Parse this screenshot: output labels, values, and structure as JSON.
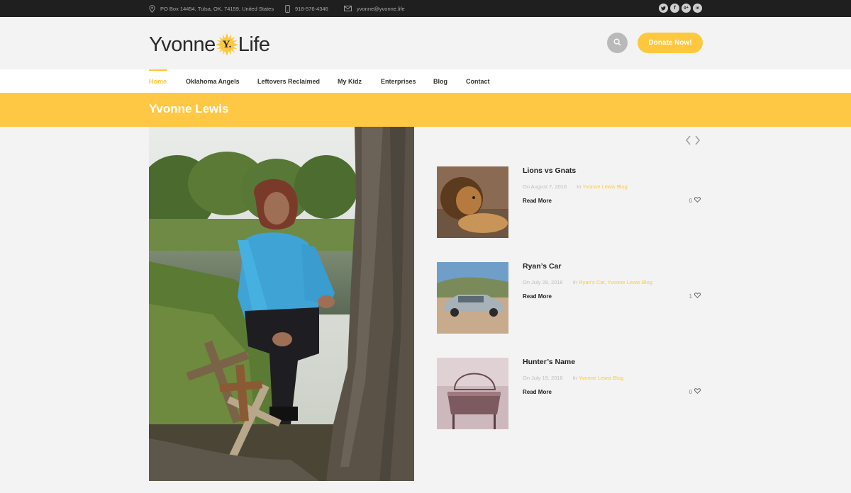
{
  "topbar": {
    "address": "PO Box 14454, Tulsa, OK, 74159, United States",
    "phone": "918-576-4346",
    "email": "yvonne@yvonne.life",
    "social": [
      "twitter-icon",
      "facebook-icon",
      "google-plus-icon",
      "linkedin-icon"
    ]
  },
  "header": {
    "logo_left": "Yvonne",
    "logo_mark": "Y.",
    "logo_right": "Life",
    "donate_label": "Donate Now!"
  },
  "nav": {
    "items": [
      {
        "label": "Home",
        "active": true
      },
      {
        "label": "Oklahoma Angels",
        "active": false
      },
      {
        "label": "Leftovers Reclaimed",
        "active": false
      },
      {
        "label": "My Kidz",
        "active": false
      },
      {
        "label": "Enterprises",
        "active": false
      },
      {
        "label": "Blog",
        "active": false
      },
      {
        "label": "Contact",
        "active": false
      }
    ]
  },
  "page": {
    "title": "Yvonne Lewis"
  },
  "posts": [
    {
      "title": "Lions vs Gnats",
      "date": "On August 7, 2016",
      "in_label": "In",
      "categories": "Yvonne Lewis Blog",
      "read_more": "Read More",
      "likes": "0"
    },
    {
      "title": "Ryan’s Car",
      "date": "On July 28, 2016",
      "in_label": "In",
      "categories": "Ryan's Car, Yvonne Lewis Blog",
      "read_more": "Read More",
      "likes": "1"
    },
    {
      "title": "Hunter’s Name",
      "date": "On July 19, 2016",
      "in_label": "In",
      "categories": "Yvonne Lewis Blog",
      "read_more": "Read More",
      "likes": "0"
    }
  ],
  "colors": {
    "accent": "#fec83e",
    "topbar": "#1f1f1f",
    "background": "#f3f3f3"
  }
}
